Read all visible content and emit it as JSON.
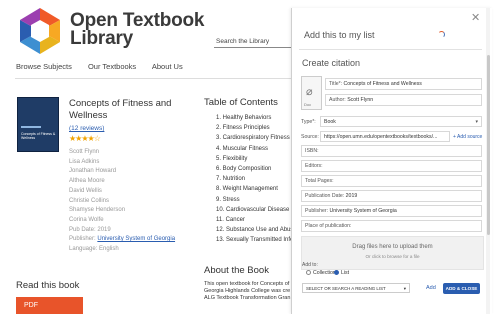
{
  "site": {
    "brand_line1": "Open Textbook",
    "brand_line2": "Library",
    "search_placeholder": "Search the Library",
    "nav": [
      "Browse Subjects",
      "Our Textbooks",
      "About Us"
    ]
  },
  "book": {
    "title": "Concepts of Fitness and Wellness",
    "reviews": "(12 reviews)",
    "stars": "★★★★☆",
    "authors": [
      "Scott Flynn",
      "Lisa Adkins",
      "Jonathan Howard",
      "Althea Moore",
      "David Wellis",
      "Christie Collins",
      "Shamyse Henderson",
      "Corina Wolfe"
    ],
    "pub_date": "Pub Date: 2019",
    "publisher_label": "Publisher: ",
    "publisher_link": "University System of Georgia",
    "language": "Language: English",
    "cover_text": "Concepts of Fitness & Wellness",
    "colors": {
      "cover": "#1f3c66",
      "accent_link": "#2a5db0",
      "star": "#f2a300",
      "pdf": "#e8542a"
    }
  },
  "read": {
    "heading": "Read this book",
    "pdf_label": "PDF"
  },
  "toc": {
    "heading": "Table of Contents",
    "items": [
      "1. Healthy Behaviors",
      "2. Fitness Principles",
      "3. Cardiorespiratory Fitness",
      "4. Muscular Fitness",
      "5. Flexibility",
      "6. Body Composition",
      "7. Nutrition",
      "8. Weight Management",
      "9. Stress",
      "10. Cardiovascular Disease",
      "11. Cancer",
      "12. Substance Use and Abuse",
      "13. Sexually Transmitted Infe"
    ]
  },
  "about": {
    "heading": "About the Book",
    "lines": [
      "This open textbook for Concepts of",
      "Georgia Highlands College was cre",
      "ALG Textbook Transformation Gran"
    ]
  },
  "panel": {
    "title": "Add this to my list",
    "create_heading": "Create citation",
    "thumb_label": "Doc",
    "fields": {
      "title_label": "Title*:",
      "title_value": "Concepts of Fitness and Wellness",
      "author_label": "Author:",
      "author_value": "Scott Flynn",
      "type_label": "Type*:",
      "type_value": "Book",
      "source_label": "Source:",
      "source_value": "https://open.umn.edu/opentextbooks/textbooks/...",
      "add_source": "+ Add source",
      "isbn_label": "ISBN:",
      "editors_label": "Editors:",
      "total_pages_label": "Total Pages:",
      "pub_date_label": "Publication Date:",
      "pub_date_value": "2019",
      "publisher_label": "Publisher:",
      "publisher_value": "University System of Georgia",
      "place_label": "Place of publication:"
    },
    "dropzone": {
      "line1": "Drag files here to upload them",
      "line2": "Or click to browse for a file"
    },
    "add_to_label": "Add to:",
    "radio_collection": "Collection",
    "radio_list": "List",
    "list_select": "SELECT OR SEARCH A READING LIST",
    "add_link": "Add",
    "add_close": "ADD & CLOSE"
  }
}
